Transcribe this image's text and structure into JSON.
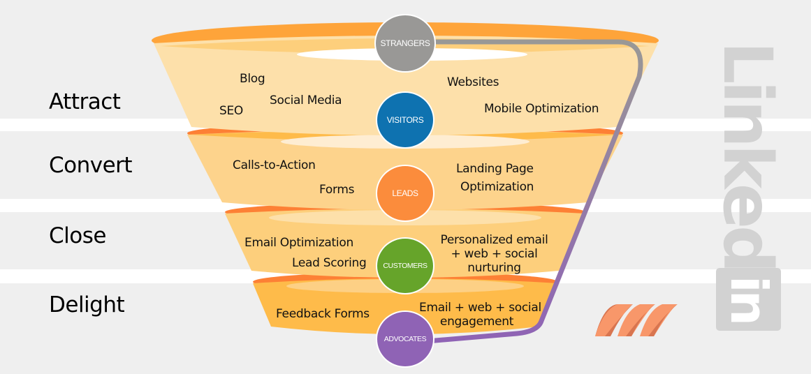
{
  "stages": [
    {
      "label": "Attract"
    },
    {
      "label": "Convert"
    },
    {
      "label": "Close"
    },
    {
      "label": "Delight"
    }
  ],
  "nodes": [
    {
      "label": "STRANGERS",
      "color": "#999896"
    },
    {
      "label": "VISITORS",
      "color": "#0e72b0"
    },
    {
      "label": "LEADS",
      "color": "#fb8c3c"
    },
    {
      "label": "CUSTOMERS",
      "color": "#66a42a"
    },
    {
      "label": "ADVOCATES",
      "color": "#8f63b5"
    }
  ],
  "tactics": {
    "attract": [
      "Blog",
      "Social Media",
      "SEO",
      "Websites",
      "Mobile Optimization"
    ],
    "convert": [
      "Calls-to-Action",
      "Forms",
      "Landing Page",
      "Optimization"
    ],
    "close": [
      "Email Optimization",
      "Lead Scoring",
      "Personalized email",
      "+ web + social",
      "nurturing"
    ],
    "delight": [
      "Feedback Forms",
      "Email + web + social",
      "engagement"
    ]
  },
  "brand": {
    "wordmark": "Linked",
    "badge": "in"
  },
  "colors": {
    "band": "#efefef",
    "funnel_light": "#fde0aa",
    "funnel_mid": "#fdcf7c",
    "funnel_rim": "#fea43a",
    "funnel_rim_dark": "#fd8035",
    "path_top": "#999896",
    "path_bottom": "#8f63b5",
    "logo_gray": "#d2d2d2",
    "stripes": "#f8976a"
  }
}
